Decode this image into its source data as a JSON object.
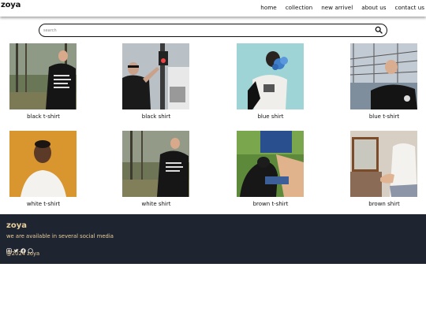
{
  "brand": {
    "logo": "zoya",
    "accent": "#e8cf9c",
    "footer_bg": "#1f2431"
  },
  "nav": {
    "items": [
      "home",
      "collection",
      "new arrivel",
      "about us",
      "contact us"
    ]
  },
  "search": {
    "placeholder": "search",
    "icon": "search-icon"
  },
  "products": [
    {
      "name": "black t-shirt",
      "bg": "#6a7756"
    },
    {
      "name": "black shirt",
      "bg": "#a8adb2"
    },
    {
      "name": "blue shirt",
      "bg": "#9fd4d6"
    },
    {
      "name": "blue t-shirt",
      "bg": "#a9b6c6"
    },
    {
      "name": "white t-shirt",
      "bg": "#d9952e"
    },
    {
      "name": "white shirt",
      "bg": "#6e7456"
    },
    {
      "name": "brown t-shirt",
      "bg": "#5c8a3a"
    },
    {
      "name": "brown shirt",
      "bg": "#d8cfc4"
    }
  ],
  "footer": {
    "logo": "zoya",
    "tagline": "we are available in several social media",
    "social_icons": [
      "instagram-icon",
      "twitter-icon",
      "facebook-icon",
      "whatsapp-icon"
    ],
    "copyright": "@2024 zoya"
  }
}
